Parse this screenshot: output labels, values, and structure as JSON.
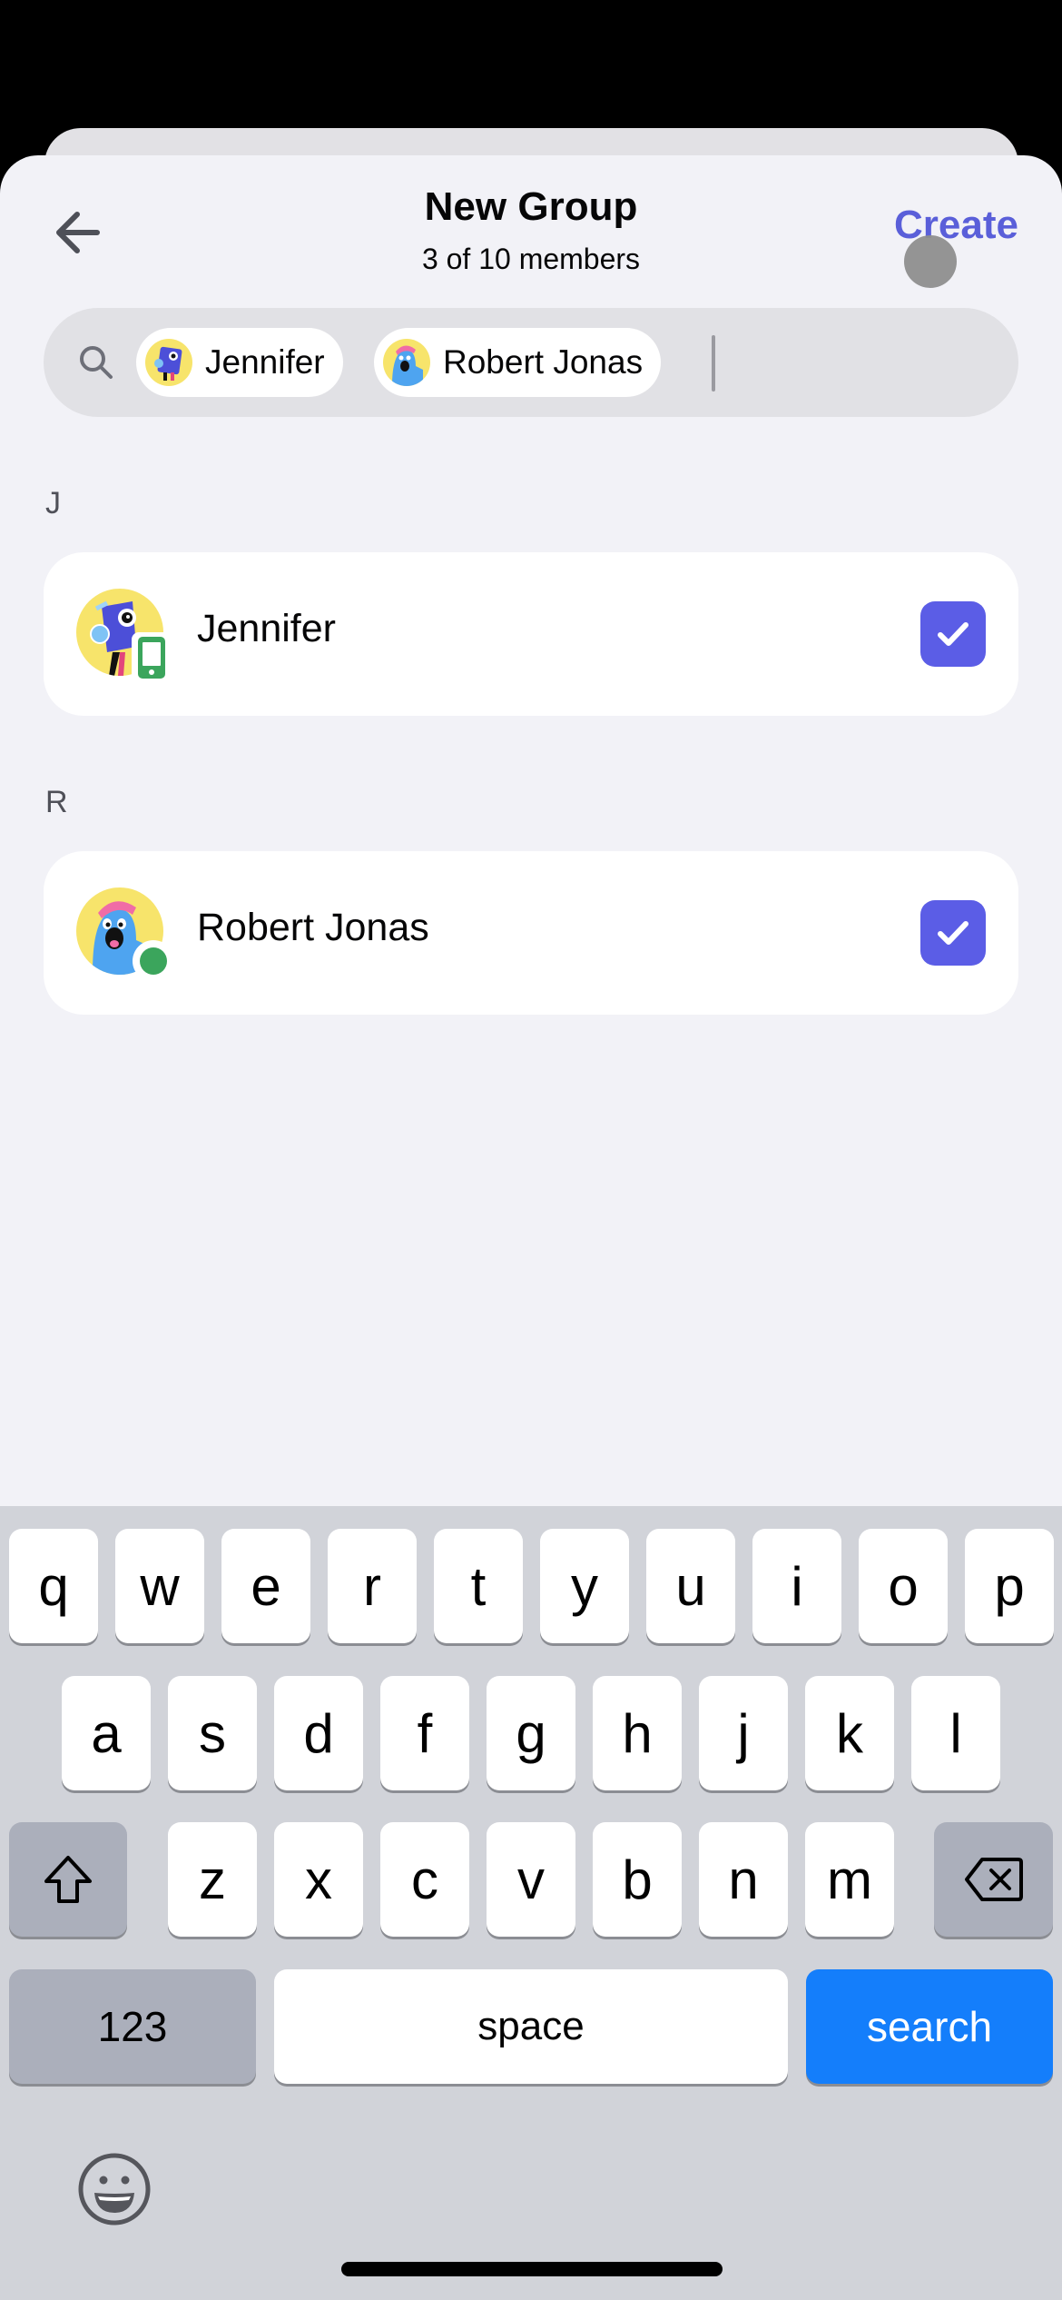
{
  "header": {
    "title": "New Group",
    "subtitle": "3 of 10 members",
    "create_label": "Create",
    "back_icon": "arrow-left-icon"
  },
  "search": {
    "icon": "search-icon",
    "value": "",
    "chips": [
      {
        "label": "Jennifer"
      },
      {
        "label": "Robert Jonas"
      }
    ]
  },
  "sections": [
    {
      "letter": "J",
      "members": [
        {
          "name": "Jennifer",
          "status": "mobile",
          "selected": true
        }
      ]
    },
    {
      "letter": "R",
      "members": [
        {
          "name": "Robert Jonas",
          "status": "online",
          "selected": true
        }
      ]
    }
  ],
  "colors": {
    "accent": "#5a5fd9",
    "checkbox": "#5b5de6",
    "online": "#3ba55c",
    "keyboard_action": "#147efb"
  },
  "keyboard": {
    "row1": [
      "q",
      "w",
      "e",
      "r",
      "t",
      "y",
      "u",
      "i",
      "o",
      "p"
    ],
    "row2": [
      "a",
      "s",
      "d",
      "f",
      "g",
      "h",
      "j",
      "k",
      "l"
    ],
    "row3": [
      "z",
      "x",
      "c",
      "v",
      "b",
      "n",
      "m"
    ],
    "numbers_label": "123",
    "space_label": "space",
    "action_label": "search",
    "shift_icon": "shift-icon",
    "delete_icon": "backspace-icon",
    "emoji_icon": "emoji-icon"
  }
}
